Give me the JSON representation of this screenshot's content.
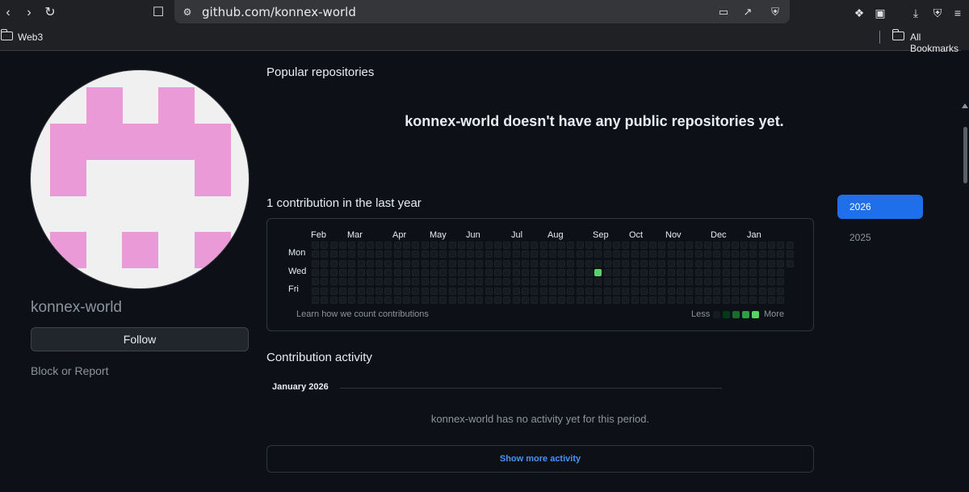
{
  "browser": {
    "url": "github.com/konnex-world",
    "bookmarks": [
      {
        "label": "Web3"
      },
      {
        "label": "All Bookmarks"
      }
    ]
  },
  "profile": {
    "username": "konnex-world",
    "follow_label": "Follow",
    "block_label": "Block or Report",
    "avatar_colors": {
      "background": "#f0f0f0",
      "foreground": "#ea9ad6"
    }
  },
  "repos": {
    "heading": "Popular repositories",
    "empty_message": "konnex-world doesn't have any public repositories yet."
  },
  "contributions": {
    "heading": "1 contribution in the last year",
    "months": [
      "Feb",
      "Mar",
      "Apr",
      "May",
      "Jun",
      "Jul",
      "Aug",
      "Sep",
      "Oct",
      "Nov",
      "Dec",
      "Jan"
    ],
    "days": [
      "Mon",
      "Wed",
      "Fri"
    ],
    "learn_link": "Learn how we count contributions",
    "legend_less": "Less",
    "legend_more": "More",
    "active_cell": {
      "month": "Sep",
      "day": "Wed",
      "count": 1
    },
    "colors": {
      "empty": "#161b22",
      "levels": [
        "#161b22",
        "#033a16",
        "#196c2e",
        "#2ea043",
        "#56d364"
      ]
    }
  },
  "years": {
    "items": [
      {
        "label": "2026",
        "selected": true
      },
      {
        "label": "2025",
        "selected": false
      }
    ],
    "accent": "#1f6feb"
  },
  "activity": {
    "heading": "Contribution activity",
    "period": "January 2026",
    "empty_message": "konnex-world has no activity yet for this period.",
    "show_more": "Show more activity"
  }
}
